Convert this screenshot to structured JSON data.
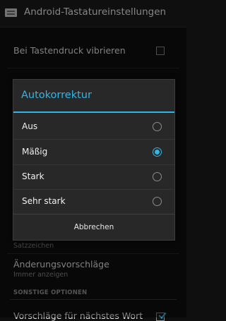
{
  "actionbar": {
    "title": "Android-Tastatureinstellungen",
    "icon": "keyboard-icon"
  },
  "settings": {
    "vibrate": {
      "title": "Bei Tastendruck vibrieren",
      "checked": false
    },
    "punctuation": {
      "summary": "Satzzeichen"
    },
    "correction_suggestions": {
      "title": "Änderungsvorschläge",
      "summary": "Immer anzeigen"
    },
    "section_other": {
      "header": "SONSTIGE OPTIONEN"
    },
    "next_word": {
      "title": "Vorschläge für nächstes Wort",
      "checked": true
    }
  },
  "dialog": {
    "title": "Autokorrektur",
    "options": [
      {
        "label": "Aus",
        "selected": false
      },
      {
        "label": "Mäßig",
        "selected": true
      },
      {
        "label": "Stark",
        "selected": false
      },
      {
        "label": "Sehr stark",
        "selected": false
      }
    ],
    "cancel_label": "Abbrechen"
  },
  "colors": {
    "accent": "#33b5e5",
    "background": "#0f0f0f",
    "dialog": "#282828"
  }
}
